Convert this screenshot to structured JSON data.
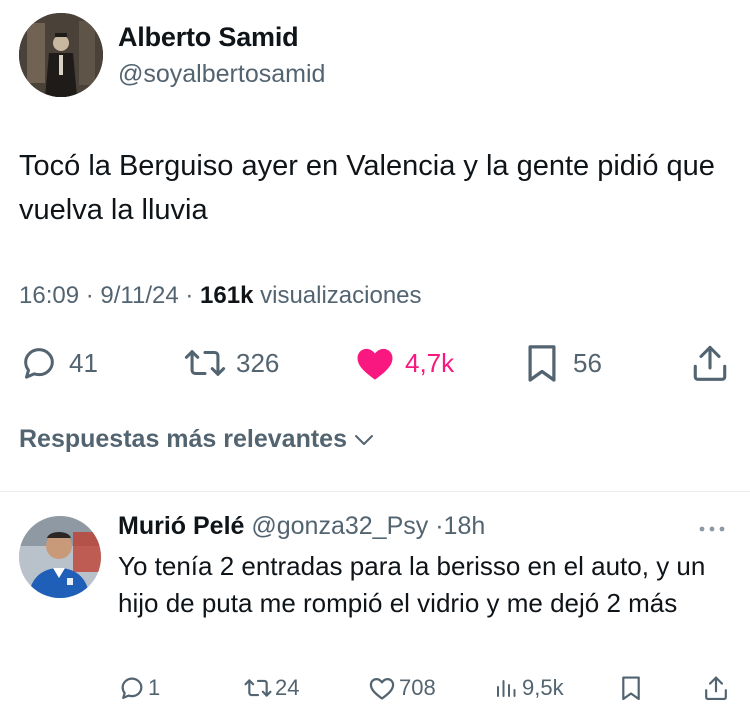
{
  "tweet": {
    "author_name": "Alberto Samid",
    "author_handle": "@soyalbertosamid",
    "text": "Tocó la Berguiso ayer en Valencia y la gente pidió que vuelva la lluvia",
    "time": "16:09",
    "date": "9/11/24",
    "views_count": "161k",
    "views_label": "visualizaciones",
    "actions": {
      "replies": "41",
      "retweets": "326",
      "likes": "4,7k",
      "bookmarks": "56"
    },
    "like_color": "#f91880",
    "icons": [
      "reply-icon",
      "retweet-icon",
      "heart-filled-icon",
      "bookmark-icon",
      "share-icon"
    ]
  },
  "replies_filter": {
    "label": "Respuestas más relevantes"
  },
  "reply": {
    "author_name": "Murió Pelé",
    "author_handle": "@gonza32_Psy",
    "time_ago": "18h",
    "text": "Yo tenía 2 entradas para la berisso en el auto, y un hijo de puta me rompió el vidrio y me dejó 2 más",
    "actions": {
      "replies": "1",
      "retweets": "24",
      "likes": "708",
      "views": "9,5k"
    },
    "icons": [
      "reply-icon",
      "retweet-icon",
      "heart-icon",
      "views-chart-icon",
      "bookmark-icon",
      "share-icon",
      "more-icon"
    ]
  },
  "colors": {
    "text_primary": "#0f1419",
    "text_secondary": "#536471",
    "divider": "#e6ecf0"
  }
}
